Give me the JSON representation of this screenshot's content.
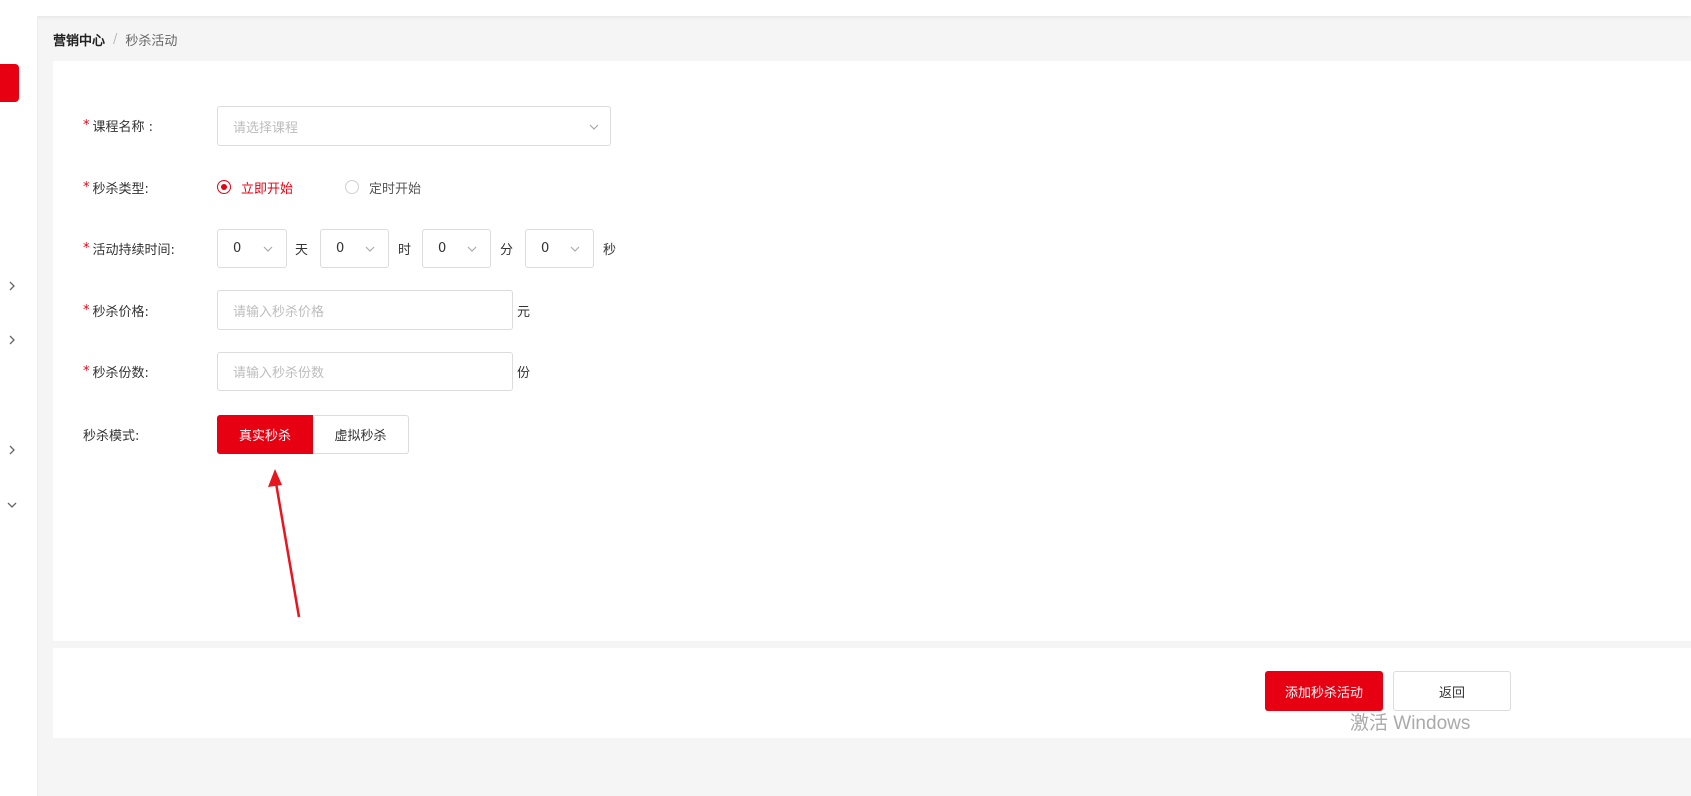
{
  "breadcrumb": {
    "root": "营销中心",
    "separator": "/",
    "current": "秒杀活动"
  },
  "form": {
    "course": {
      "label": "课程名称 :",
      "placeholder": "请选择课程"
    },
    "type": {
      "label": "秒杀类型:",
      "options": [
        "立即开始",
        "定时开始"
      ],
      "selected": "立即开始"
    },
    "duration": {
      "label": "活动持续时间:",
      "days": {
        "value": "0",
        "unit": "天"
      },
      "hours": {
        "value": "0",
        "unit": "时"
      },
      "minutes": {
        "value": "0",
        "unit": "分"
      },
      "seconds": {
        "value": "0",
        "unit": "秒"
      }
    },
    "price": {
      "label": "秒杀价格:",
      "placeholder": "请输入秒杀价格",
      "unit": "元"
    },
    "count": {
      "label": "秒杀份数:",
      "placeholder": "请输入秒杀份数",
      "unit": "份"
    },
    "mode": {
      "label": "秒杀模式:",
      "options": [
        "真实秒杀",
        "虚拟秒杀"
      ],
      "selected": "真实秒杀"
    }
  },
  "actions": {
    "submit": "添加秒杀活动",
    "back": "返回"
  },
  "watermark": "激活 Windows",
  "colors": {
    "accent": "#e60012"
  }
}
